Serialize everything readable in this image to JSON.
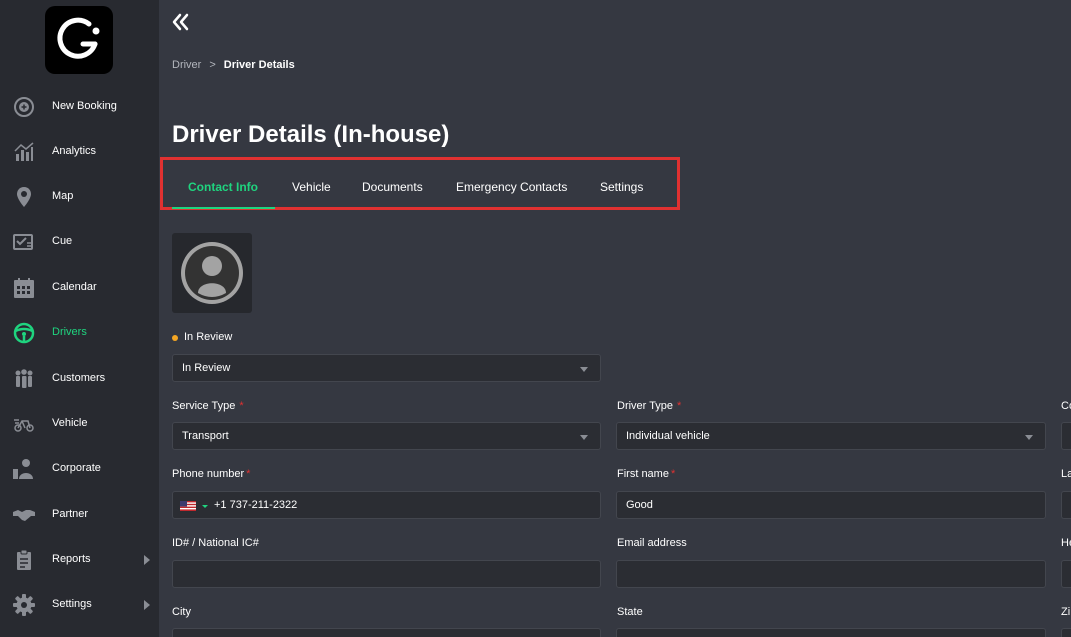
{
  "sidebar": {
    "items": [
      {
        "label": "New Booking",
        "icon": "plus-circle-icon"
      },
      {
        "label": "Analytics",
        "icon": "analytics-icon"
      },
      {
        "label": "Map",
        "icon": "map-pin-icon"
      },
      {
        "label": "Cue",
        "icon": "cue-icon"
      },
      {
        "label": "Calendar",
        "icon": "calendar-icon"
      },
      {
        "label": "Drivers",
        "icon": "steering-wheel-icon"
      },
      {
        "label": "Customers",
        "icon": "customers-icon"
      },
      {
        "label": "Vehicle",
        "icon": "vehicle-icon"
      },
      {
        "label": "Corporate",
        "icon": "corporate-icon"
      },
      {
        "label": "Partner",
        "icon": "handshake-icon"
      },
      {
        "label": "Reports",
        "icon": "reports-icon"
      },
      {
        "label": "Settings",
        "icon": "gear-icon"
      }
    ],
    "active": "Drivers"
  },
  "breadcrumb": {
    "parent": "Driver",
    "separator": ">",
    "current": "Driver Details"
  },
  "page_title": "Driver Details (In-house)",
  "tabs": [
    {
      "label": "Contact Info"
    },
    {
      "label": "Vehicle"
    },
    {
      "label": "Documents"
    },
    {
      "label": "Emergency Contacts"
    },
    {
      "label": "Settings"
    }
  ],
  "status": {
    "label": "In Review",
    "select_value": "In Review"
  },
  "form": {
    "service_type": {
      "label": "Service Type",
      "value": "Transport"
    },
    "driver_type": {
      "label": "Driver Type",
      "value": "Individual vehicle"
    },
    "col3_row1_label": "Co",
    "phone": {
      "label": "Phone number",
      "value": "+1 737-211-2322"
    },
    "first_name": {
      "label": "First name",
      "value": "Good"
    },
    "col3_row2_label": "La",
    "id_number": {
      "label": "ID# / National IC#",
      "value": ""
    },
    "email": {
      "label": "Email address",
      "value": ""
    },
    "col3_row3_label": "He",
    "city": {
      "label": "City"
    },
    "state": {
      "label": "State"
    },
    "col3_row4_label": "Zi"
  },
  "colors": {
    "accent": "#1fd47f",
    "highlight": "#e03131",
    "status_dot": "#f5a623"
  }
}
